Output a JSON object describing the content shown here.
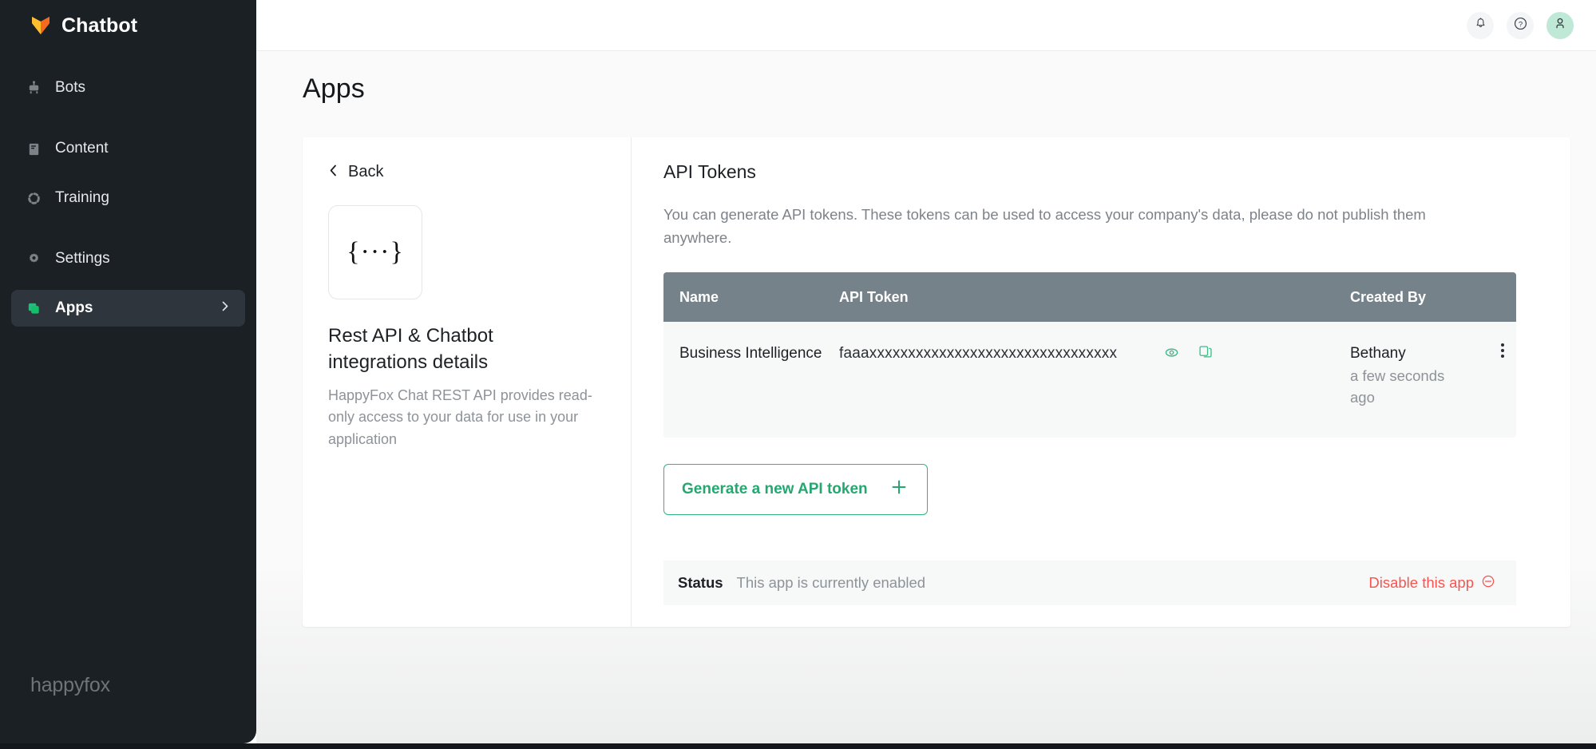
{
  "brand": {
    "name": "Chatbot",
    "logo_icon": "happyfox-fox-logo-icon"
  },
  "sidebar": {
    "items": [
      {
        "label": "Bots",
        "icon": "robot-icon",
        "active": false
      },
      {
        "label": "Content",
        "icon": "book-icon",
        "active": false
      },
      {
        "label": "Training",
        "icon": "dotted-circle-icon",
        "active": false
      },
      {
        "label": "Settings",
        "icon": "gear-icon",
        "active": false
      },
      {
        "label": "Apps",
        "icon": "apps-stack-icon",
        "active": true
      }
    ],
    "footer_logo_text": "happyfox",
    "active_chevron_icon": "chevron-right-icon"
  },
  "topbar": {
    "notifications_icon": "bell-icon",
    "help_icon": "question-circle-icon",
    "account_icon": "user-avatar-icon",
    "avatar_bg": "#bfe8d6"
  },
  "page": {
    "title": "Apps"
  },
  "detail": {
    "back_label": "Back",
    "back_icon": "chevron-left-icon",
    "tile_glyph": "{···}",
    "app_title": "Rest API & Chatbot integrations details",
    "app_description": "HappyFox Chat REST API provides read-only access to your data for use in your application"
  },
  "tokens": {
    "section_title": "API Tokens",
    "section_description": "You can generate API tokens. These tokens can be used to access your company's data, please do not publish them anywhere.",
    "columns": {
      "name": "Name",
      "token": "API Token",
      "created_by": "Created By"
    },
    "header_bg": "#76828a",
    "rows": [
      {
        "name": "Business Intelligence",
        "token": "faaaxxxxxxxxxxxxxxxxxxxxxxxxxxxxxxxx",
        "reveal_icon": "eye-icon",
        "copy_icon": "copy-icon",
        "created_by": "Bethany",
        "created_when": "a few seconds ago",
        "menu_icon": "kebab-menu-icon"
      }
    ],
    "generate_button": {
      "label": "Generate a new API token",
      "icon": "plus-icon",
      "accent": "#25a870"
    }
  },
  "status": {
    "label": "Status",
    "value": "This app is currently enabled",
    "action_label": "Disable this app",
    "action_icon": "minus-circle-icon",
    "action_color": "#f9534f"
  }
}
